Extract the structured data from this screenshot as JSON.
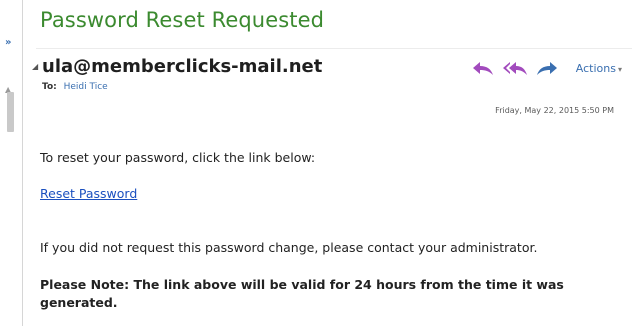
{
  "subject": "Password Reset Requested",
  "message": {
    "sender": "ula@memberclicks-mail.net",
    "to_label": "To:",
    "to_name": "Heidi Tice",
    "date": "Friday, May 22, 2015 5:50 PM"
  },
  "toolbar": {
    "reply_icon": "reply-icon",
    "reply_all_icon": "reply-all-icon",
    "forward_icon": "forward-icon",
    "actions_label": "Actions",
    "actions_caret": "▾"
  },
  "body": {
    "paragraph1": "To reset your password, click the link below:",
    "link_text": "Reset Password",
    "paragraph2": "If you did not request this password change, please contact your administrator.",
    "note": "Please Note: The link above will be valid for 24 hours from the time it was generated."
  },
  "colors": {
    "subject_green": "#3b8a2f",
    "link_blue": "#1a4fbf",
    "icon_purple": "#a24bbd",
    "icon_blue": "#3a6fb0"
  }
}
